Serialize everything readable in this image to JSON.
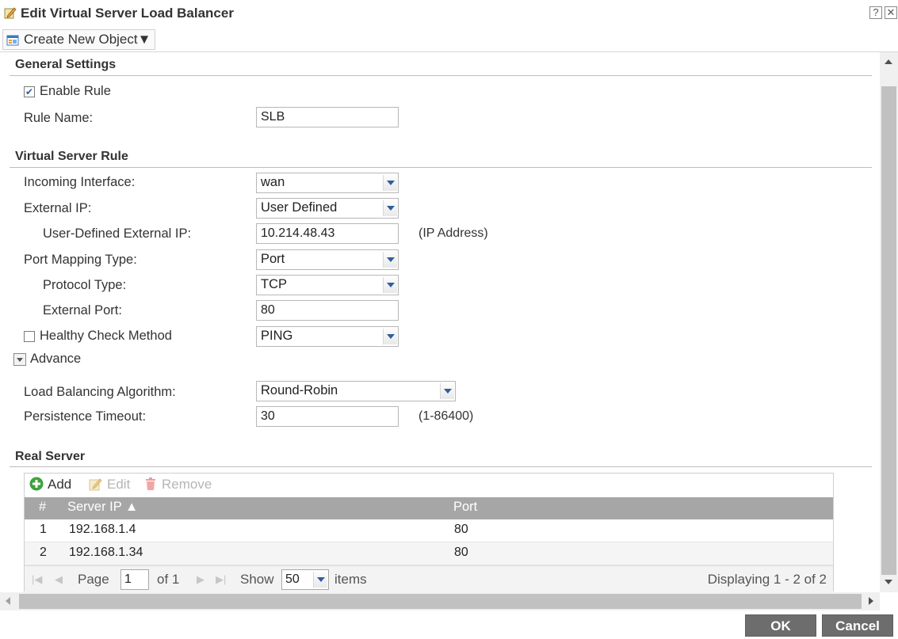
{
  "window": {
    "title": "Edit Virtual Server Load Balancer",
    "help_label": "?",
    "close_label": "✕"
  },
  "toolbar": {
    "create_label": "Create New Object▼"
  },
  "general": {
    "section_title": "General Settings",
    "enable_label": "Enable Rule",
    "enable_checked": true,
    "rule_name_label": "Rule Name:",
    "rule_name_value": "SLB"
  },
  "vs_rule": {
    "section_title": "Virtual Server Rule",
    "incoming_label": "Incoming Interface:",
    "incoming_value": "wan",
    "external_ip_label": "External IP:",
    "external_ip_value": "User Defined",
    "user_ip_label": "User-Defined External IP:",
    "user_ip_value": "10.214.48.43",
    "user_ip_hint": "(IP Address)",
    "port_mapping_label": "Port Mapping Type:",
    "port_mapping_value": "Port",
    "protocol_label": "Protocol Type:",
    "protocol_value": "TCP",
    "external_port_label": "External Port:",
    "external_port_value": "80",
    "health_label": "Healthy Check Method",
    "health_checked": false,
    "health_value": "PING"
  },
  "advance": {
    "toggle_label": "Advance",
    "lb_algo_label": "Load Balancing Algorithm:",
    "lb_algo_value": "Round-Robin",
    "persistence_label": "Persistence Timeout:",
    "persistence_value": "30",
    "persistence_hint": "(1-86400)"
  },
  "real_server": {
    "section_title": "Real Server",
    "add_label": "Add",
    "edit_label": "Edit",
    "remove_label": "Remove",
    "columns": {
      "num": "#",
      "ip": "Server IP ▲",
      "port": "Port"
    },
    "rows": [
      {
        "num": "1",
        "ip": "192.168.1.4",
        "port": "80"
      },
      {
        "num": "2",
        "ip": "192.168.1.34",
        "port": "80"
      }
    ],
    "pager": {
      "page_label": "Page",
      "page_value": "1",
      "of_label": "of 1",
      "show_label": "Show",
      "show_value": "50",
      "items_label": "items",
      "displaying": "Displaying 1 - 2 of 2"
    }
  },
  "footer": {
    "ok_label": "OK",
    "cancel_label": "Cancel"
  },
  "colors": {
    "add_green": "#3ea23e",
    "header_gray": "#a6a6a6",
    "button_gray": "#6d6d6d",
    "select_arrow": "#2f5f9d"
  }
}
